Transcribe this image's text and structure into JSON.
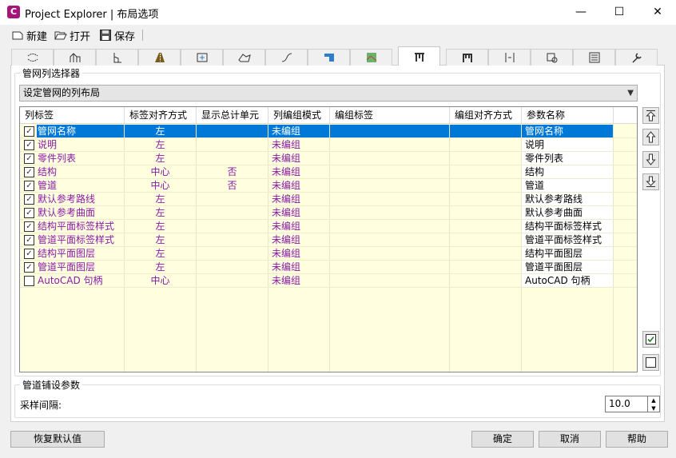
{
  "window": {
    "app_icon_letter": "C",
    "title": "Project Explorer | 布局选项",
    "minimize": "—",
    "maximize": "☐",
    "close": "✕"
  },
  "toolbar": {
    "new_label": "新建",
    "open_label": "打开",
    "save_label": "保存"
  },
  "tabs": [
    {
      "icon": "alignment-tab-icon"
    },
    {
      "icon": "profile-tab-icon"
    },
    {
      "icon": "profile-view-tab-icon"
    },
    {
      "icon": "corridor-tab-icon"
    },
    {
      "icon": "assembly-tab-icon"
    },
    {
      "icon": "surface-tab-icon"
    },
    {
      "icon": "feature-line-tab-icon"
    },
    {
      "icon": "parcel-tab-icon"
    },
    {
      "icon": "map-tab-icon"
    },
    {
      "icon": "pipe-network-tab-icon",
      "active": true
    },
    {
      "icon": "pressure-network-tab-icon"
    },
    {
      "icon": "section-tab-icon"
    },
    {
      "icon": "point-tab-icon"
    },
    {
      "icon": "list-tab-icon"
    },
    {
      "icon": "settings-tab-icon"
    }
  ],
  "column_selector": {
    "group_label": "管网列选择器",
    "layout_combo_value": "设定管网的列布局"
  },
  "grid": {
    "columns": [
      "列标签",
      "标签对齐方式",
      "显示总计单元",
      "列编组模式",
      "编组标签",
      "编组对齐方式",
      "参数名称"
    ],
    "rows": [
      {
        "checked": true,
        "label": "管网名称",
        "align": "左",
        "total": "",
        "mode": "未编组",
        "group_label": "",
        "group_align": "",
        "param": "管网名称",
        "selected": true
      },
      {
        "checked": true,
        "label": "说明",
        "align": "左",
        "total": "",
        "mode": "未编组",
        "group_label": "",
        "group_align": "",
        "param": "说明"
      },
      {
        "checked": true,
        "label": "零件列表",
        "align": "左",
        "total": "",
        "mode": "未编组",
        "group_label": "",
        "group_align": "",
        "param": "零件列表"
      },
      {
        "checked": true,
        "label": "结构",
        "align": "中心",
        "total": "否",
        "mode": "未编组",
        "group_label": "",
        "group_align": "",
        "param": "结构"
      },
      {
        "checked": true,
        "label": "管道",
        "align": "中心",
        "total": "否",
        "mode": "未编组",
        "group_label": "",
        "group_align": "",
        "param": "管道"
      },
      {
        "checked": true,
        "label": "默认参考路线",
        "align": "左",
        "total": "",
        "mode": "未编组",
        "group_label": "",
        "group_align": "",
        "param": "默认参考路线"
      },
      {
        "checked": true,
        "label": "默认参考曲面",
        "align": "左",
        "total": "",
        "mode": "未编组",
        "group_label": "",
        "group_align": "",
        "param": "默认参考曲面"
      },
      {
        "checked": true,
        "label": "结构平面标签样式",
        "align": "左",
        "total": "",
        "mode": "未编组",
        "group_label": "",
        "group_align": "",
        "param": "结构平面标签样式"
      },
      {
        "checked": true,
        "label": "管道平面标签样式",
        "align": "左",
        "total": "",
        "mode": "未编组",
        "group_label": "",
        "group_align": "",
        "param": "管道平面标签样式"
      },
      {
        "checked": true,
        "label": "结构平面图层",
        "align": "左",
        "total": "",
        "mode": "未编组",
        "group_label": "",
        "group_align": "",
        "param": "结构平面图层"
      },
      {
        "checked": true,
        "label": "管道平面图层",
        "align": "左",
        "total": "",
        "mode": "未编组",
        "group_label": "",
        "group_align": "",
        "param": "管道平面图层"
      },
      {
        "checked": false,
        "label": "AutoCAD 句柄",
        "align": "中心",
        "total": "",
        "mode": "未编组",
        "group_label": "",
        "group_align": "",
        "param": "AutoCAD 句柄"
      }
    ]
  },
  "side_buttons": [
    "move-top-icon",
    "move-up-icon",
    "move-down-icon",
    "move-bottom-icon",
    "check-all-icon",
    "uncheck-all-icon"
  ],
  "routing": {
    "group_label": "管道铺设参数",
    "sampling_label": "采样间隔:",
    "sampling_value": "10.0"
  },
  "buttons": {
    "restore_defaults": "恢复默认值",
    "ok": "确定",
    "cancel": "取消",
    "help": "帮助"
  },
  "colors": {
    "selection": "#0078d7",
    "label_text": "#8b1ba6",
    "grid_background": "#ffffe0",
    "app_icon": "#a4167a"
  }
}
